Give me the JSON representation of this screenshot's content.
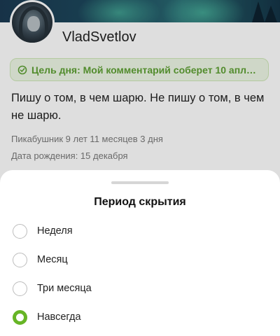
{
  "profile": {
    "username": "VladSvetlov",
    "goal": "Цель дня: Мой комментарий соберет 10 аплод...",
    "bio": "Пишу о том, в чем шарю. Не пишу о том, в чем не шарю.",
    "tenure": "Пикабушник 9 лет 11 месяцев 3 дня",
    "birthday": "Дата рождения: 15 декабря"
  },
  "sheet": {
    "title": "Период скрытия",
    "options": [
      {
        "label": "Неделя",
        "selected": false
      },
      {
        "label": "Месяц",
        "selected": false
      },
      {
        "label": "Три месяца",
        "selected": false
      },
      {
        "label": "Навсегда",
        "selected": true
      }
    ]
  },
  "colors": {
    "accent_green": "#67b526",
    "goal_text": "#5fa134"
  },
  "icons": {
    "goal": "target-check-icon"
  }
}
